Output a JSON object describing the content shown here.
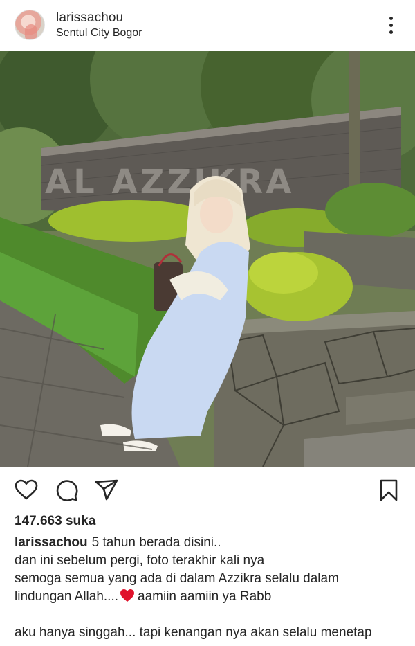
{
  "post": {
    "username": "larissachou",
    "location": "Sentul City Bogor",
    "likes": "147.663 suka",
    "caption": {
      "username": "larissachou",
      "line1": "5 tahun berada disini..",
      "line2": "dan ini sebelum pergi, foto terakhir kali nya",
      "line3": "semoga semua yang ada di dalam Azzikra selalu dalam",
      "line4_before": "lindungan Allah....",
      "line4_after": "aamiin aamiin ya Rabb",
      "line5": "aku hanya singgah... tapi kenangan nya akan selalu menetap"
    },
    "photo_sign_text": "AL AZZIKRA"
  },
  "icons": {
    "more": "more-vertical-icon",
    "like": "heart-outline-icon",
    "comment": "comment-bubble-icon",
    "share": "paper-plane-icon",
    "save": "bookmark-outline-icon",
    "emoji": "red-heart-emoji"
  },
  "colors": {
    "text": "#262626",
    "emoji_heart": "#e0132c",
    "dress": "#c9d9f2"
  }
}
